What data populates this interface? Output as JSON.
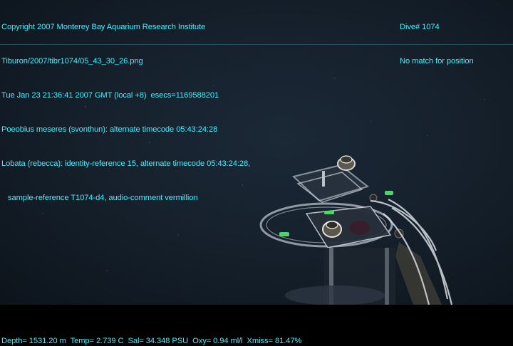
{
  "overlay": {
    "lines_left": [
      "Copyright 2007 Monterey Bay Aquarium Research Institute",
      "Tiburon/2007/tibr1074/05_43_30_26.png",
      "Tue Jan 23 21:36:41 2007 GMT (local +8)  esecs=1169588201",
      "Poeobius meseres (svonthun): alternate timecode 05:43:24:28",
      "Lobata (rebecca): identity-reference 15, alternate timecode 05:43:24:28,",
      "   sample-reference T1074-d4, audio-comment vermillion"
    ],
    "lines_right": [
      "Dive# 1074",
      "No match for position"
    ],
    "bottom_line": "Depth= 1531.20 m  Temp= 2.739 C  Sal= 34.348 PSU  Oxy= 0.94 ml/l  Xmiss= 81.47%"
  },
  "colors": {
    "overlay_text": "#3ff2ff",
    "water": "#16212d"
  }
}
